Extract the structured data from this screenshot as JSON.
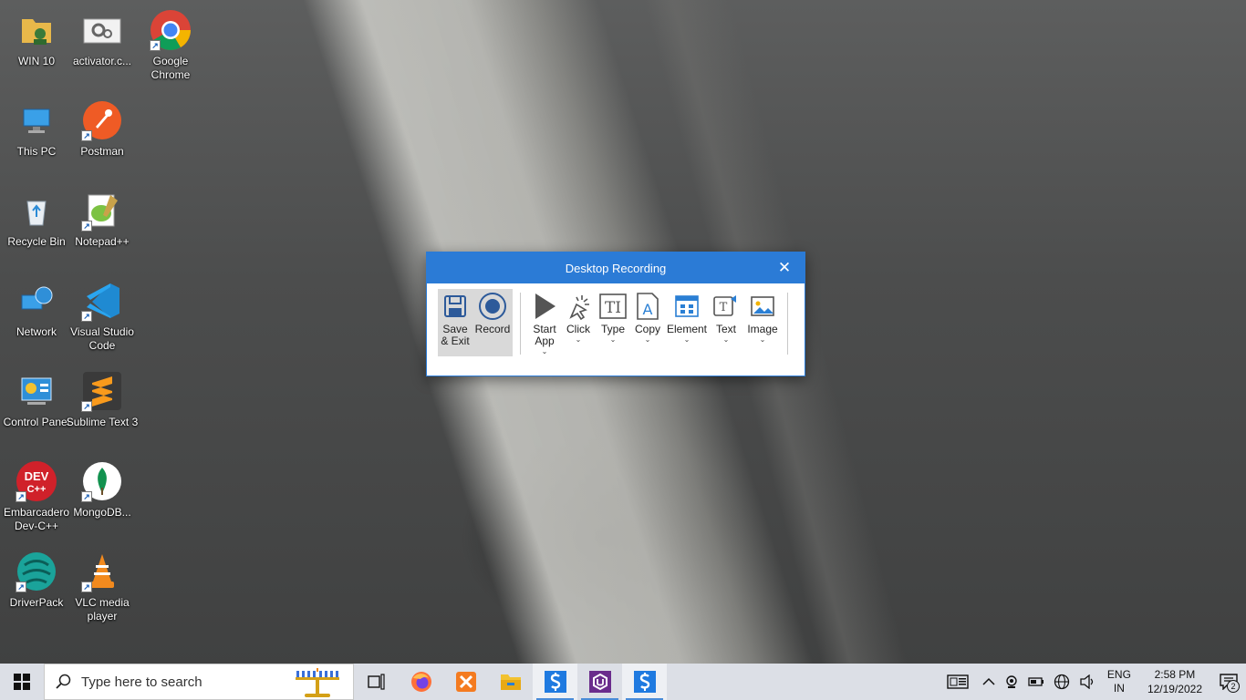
{
  "desktop": {
    "icons": [
      {
        "label": "WIN 10"
      },
      {
        "label": "activator.c..."
      },
      {
        "label": "Google Chrome"
      },
      {
        "label": "This PC"
      },
      {
        "label": "Postman"
      },
      {
        "label": "Recycle Bin"
      },
      {
        "label": "Notepad++"
      },
      {
        "label": "Network"
      },
      {
        "label": "Visual Studio Code"
      },
      {
        "label": "Control Panel"
      },
      {
        "label": "Sublime Text 3"
      },
      {
        "label": "Embarcadero Dev-C++"
      },
      {
        "label": "MongoDB..."
      },
      {
        "label": "DriverPack"
      },
      {
        "label": "VLC media player"
      }
    ]
  },
  "recording_window": {
    "title": "Desktop Recording",
    "close_glyph": "✕",
    "buttons": {
      "save_exit": "Save & Exit",
      "record": "Record",
      "start_app": "Start App",
      "click": "Click",
      "type": "Type",
      "copy": "Copy",
      "element": "Element",
      "text": "Text",
      "image": "Image"
    },
    "accent": "#2b7bd6"
  },
  "taskbar": {
    "search_placeholder": "Type here to search",
    "language": {
      "line1": "ENG",
      "line2": "IN"
    },
    "clock": {
      "time": "2:58 PM",
      "date": "12/19/2022"
    },
    "notification_count": "2"
  }
}
